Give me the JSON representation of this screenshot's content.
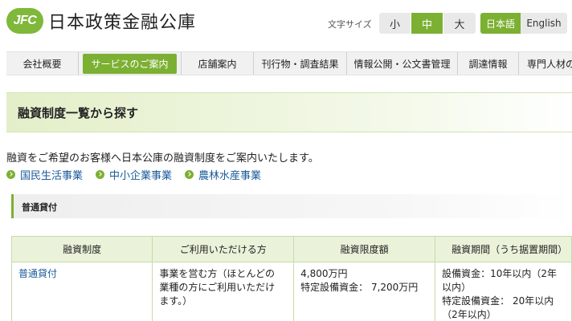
{
  "header": {
    "logo_mark": "JFC",
    "logo_text": "日本政策金融公庫",
    "font_size_label": "文字サイズ",
    "font_sizes": [
      "小",
      "中",
      "大"
    ],
    "languages": [
      "日本語",
      "English"
    ]
  },
  "nav": {
    "items": [
      "会社概要",
      "サービスのご案内",
      "店舗案内",
      "刊行物・調査結果",
      "情報公開・公文書管理",
      "調達情報",
      "専門人材の"
    ]
  },
  "page": {
    "title": "融資制度一覧から探す",
    "intro": "融資をご希望のお客様へ日本公庫の融資制度をご案内いたします。",
    "quick_links": [
      "国民生活事業",
      "中小企業事業",
      "農林水産事業"
    ]
  },
  "section": {
    "title": "普通貸付"
  },
  "table": {
    "headers": [
      "融資制度",
      "ご利用いただける方",
      "融資限度額",
      "融資期間（うち据置期間）"
    ],
    "row": {
      "name": "普通貸付",
      "eligible": [
        "事業を営む方（ほとんどの",
        "業種の方にご利用いただけ",
        "ます。）"
      ],
      "limit": [
        "4,800万円",
        "特定設備資金： 7,200万円"
      ],
      "period": [
        "設備資金：10年以内（2年",
        "以内）",
        "特定設備資金： 20年以内",
        "（2年以内）"
      ]
    }
  },
  "colors": {
    "accent_green": "#7cb032",
    "link_blue": "#1a5a9a"
  }
}
